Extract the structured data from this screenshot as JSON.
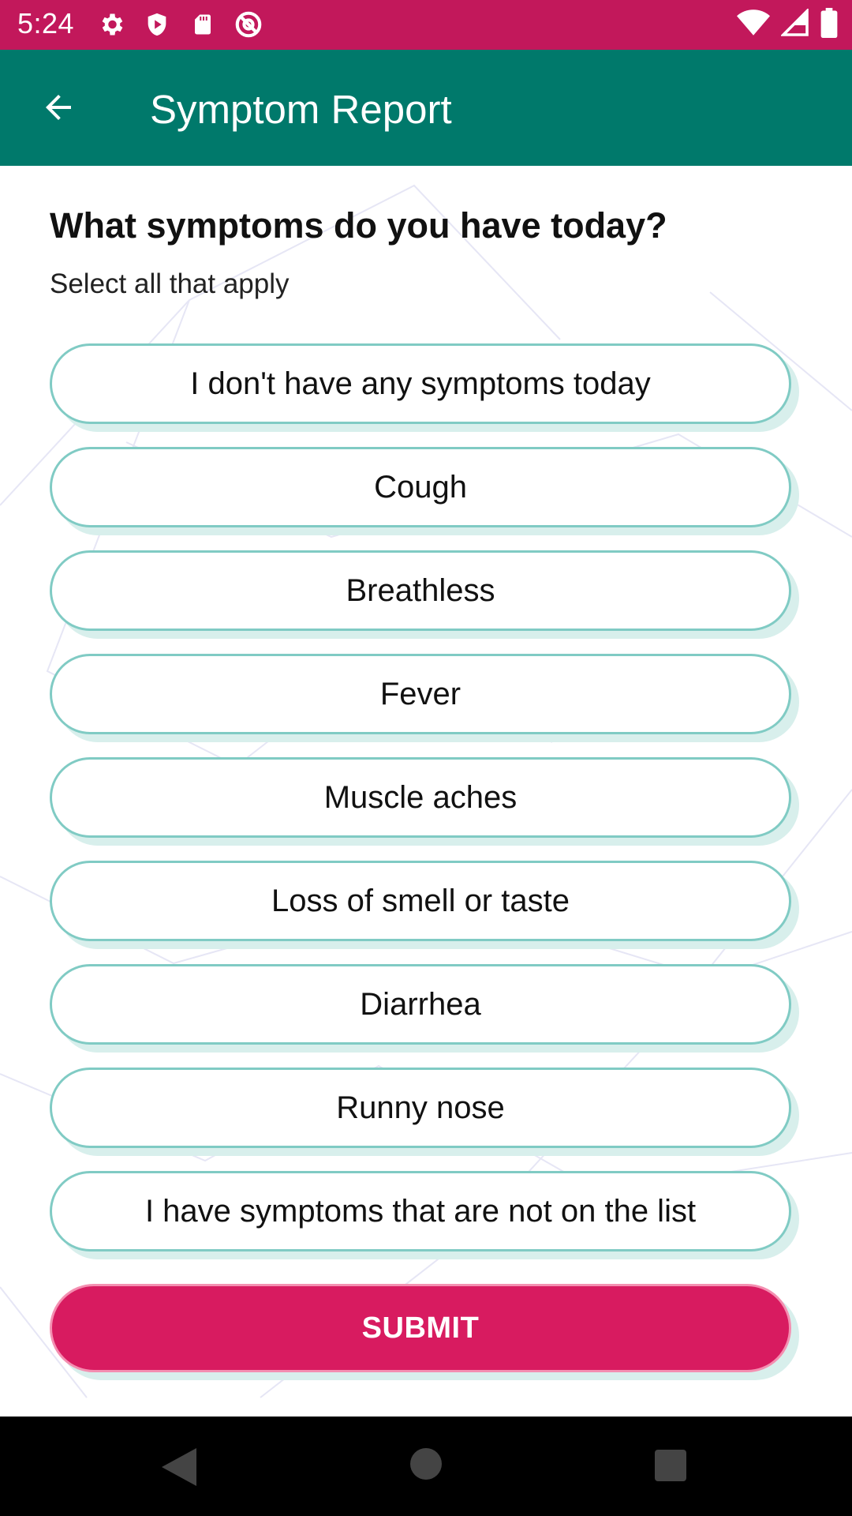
{
  "status_bar": {
    "time": "5:24",
    "left_icons": [
      "settings-icon",
      "shield-play-icon",
      "sd-card-icon",
      "at-sign-icon"
    ],
    "right_icons": [
      "wifi-icon",
      "signal-icon",
      "battery-icon"
    ]
  },
  "app_bar": {
    "title": "Symptom Report",
    "back_icon": "arrow-back-icon",
    "color": "#00796b"
  },
  "main": {
    "question": "What symptoms do you have today?",
    "instruction": "Select all that apply",
    "options": [
      {
        "label": "I don't have any symptoms today"
      },
      {
        "label": "Cough"
      },
      {
        "label": "Breathless"
      },
      {
        "label": "Fever"
      },
      {
        "label": "Muscle aches"
      },
      {
        "label": "Loss of smell or taste"
      },
      {
        "label": "Diarrhea"
      },
      {
        "label": "Runny nose"
      },
      {
        "label": "I have symptoms that are not on the list"
      }
    ],
    "submit_label": "SUBMIT",
    "accent_color": "#d81b60",
    "option_border_color": "#80cbc4"
  },
  "nav_bar": {
    "icons": [
      "nav-back-icon",
      "nav-home-icon",
      "nav-recents-icon"
    ]
  }
}
